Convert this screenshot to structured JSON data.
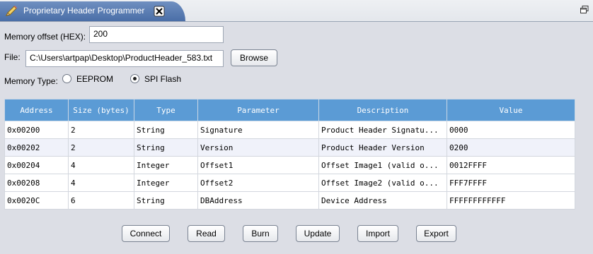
{
  "window": {
    "tab_title": "Proprietary Header Programmer"
  },
  "form": {
    "memory_offset_label": "Memory offset (HEX):",
    "memory_offset_value": "200",
    "file_label": "File:",
    "file_value": "C:\\Users\\artpap\\Desktop\\ProductHeader_583.txt",
    "browse_label": "Browse",
    "memory_type_label": "Memory Type:",
    "memory_type_options": [
      "EEPROM",
      "SPI Flash"
    ],
    "memory_type_selected": "SPI Flash"
  },
  "table": {
    "columns": [
      "Address",
      "Size (bytes)",
      "Type",
      "Parameter",
      "Description",
      "Value"
    ],
    "rows": [
      [
        "0x00200",
        "2",
        "String",
        "Signature",
        "Product Header Signatu...",
        "0000"
      ],
      [
        "0x00202",
        "2",
        "String",
        "Version",
        "Product Header Version",
        "0200"
      ],
      [
        "0x00204",
        "4",
        "Integer",
        "Offset1",
        "Offset Image1 (valid o...",
        "0012FFFF"
      ],
      [
        "0x00208",
        "4",
        "Integer",
        "Offset2",
        "Offset Image2 (valid o...",
        "FFF7FFFF"
      ],
      [
        "0x0020C",
        "6",
        "String",
        "DBAddress",
        "Device Address",
        "FFFFFFFFFFFF"
      ]
    ]
  },
  "actions": [
    "Connect",
    "Read",
    "Burn",
    "Update",
    "Import",
    "Export"
  ],
  "colors": {
    "tab": "#4a6ea7",
    "table_header": "#5b9bd5",
    "background": "#dcdee5"
  }
}
